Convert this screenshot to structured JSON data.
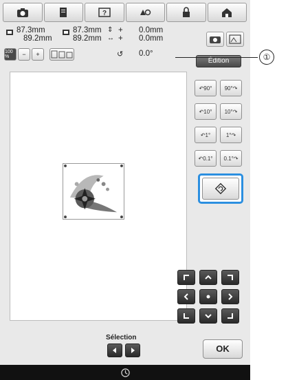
{
  "toolbar": {
    "icons": [
      "camera-icon",
      "page-icon",
      "help-icon",
      "sewing-icon",
      "lock-icon",
      "home-icon"
    ]
  },
  "info": {
    "width_value": "87.3mm",
    "height_value": "89.2mm",
    "width2_value": "87.3mm",
    "height2_value": "89.2mm",
    "v_offset_value": "0.0mm",
    "h_offset_value": "0.0mm",
    "v_plus": "+",
    "h_plus": "+",
    "rotation_value": "0.0°",
    "zoom_level": "100 %"
  },
  "edition_label": "Édition",
  "callout_number": "①",
  "rotation_buttons": [
    {
      "label": "90°",
      "dir": "left"
    },
    {
      "label": "90°",
      "dir": "right"
    },
    {
      "label": "10°",
      "dir": "left"
    },
    {
      "label": "10°",
      "dir": "right"
    },
    {
      "label": "1°",
      "dir": "left"
    },
    {
      "label": "1°",
      "dir": "right"
    },
    {
      "label": "0.1°",
      "dir": "left"
    },
    {
      "label": "0.1°",
      "dir": "right"
    }
  ],
  "selection_label": "Sélection",
  "ok_label": "OK",
  "colors": {
    "highlight": "#2b8fe0",
    "panel": "#e9e9e9",
    "footer": "#111111"
  }
}
